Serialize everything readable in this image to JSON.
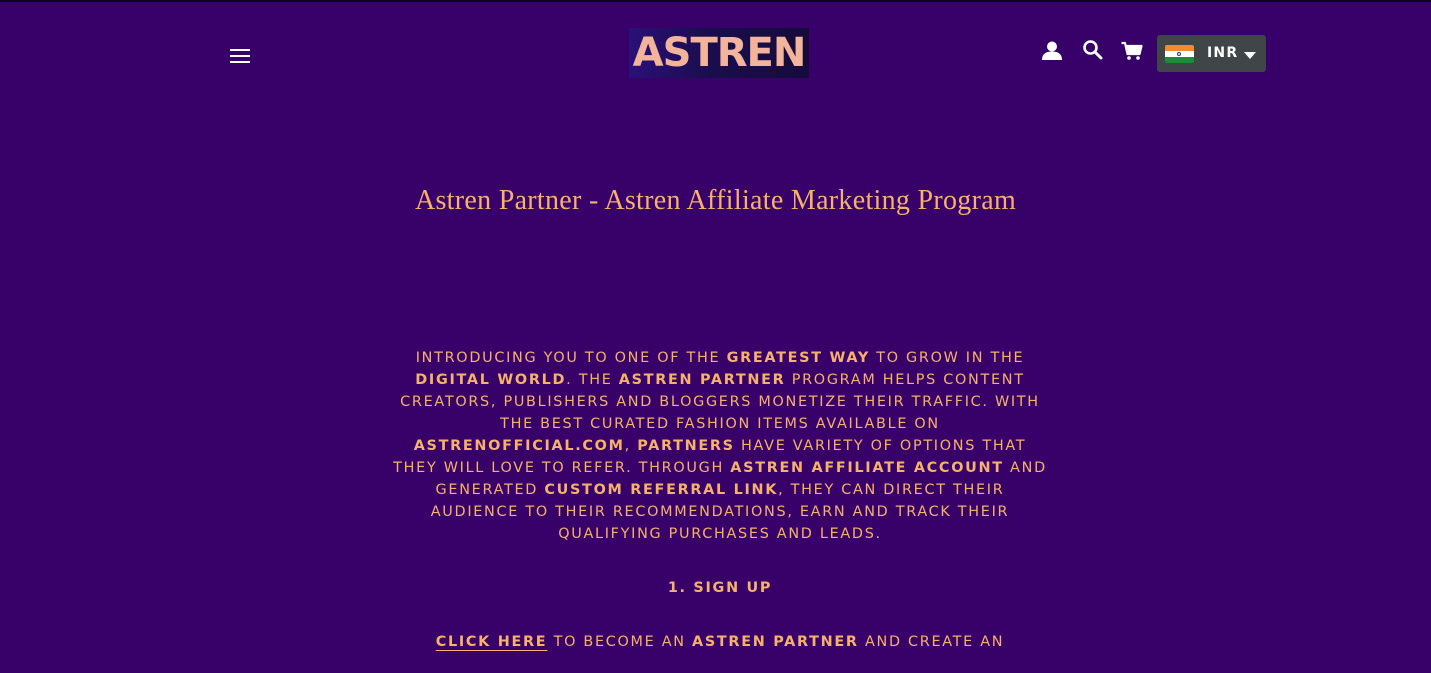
{
  "header": {
    "logo_text": "ASTREN",
    "menu_icon": "hamburger-menu-icon",
    "account_icon": "user-icon",
    "search_icon": "search-icon",
    "cart_icon": "cart-icon",
    "currency": {
      "flag_icon": "india-flag-icon",
      "code": "INR",
      "caret_icon": "caret-down-icon"
    }
  },
  "page": {
    "title": "Astren Partner - Astren Affiliate Marketing Program"
  },
  "intro": {
    "t1": "Introducing you to one of the ",
    "b1": "greatest way",
    "t2": " to grow in the ",
    "b2": "digital world",
    "t3": ". The ",
    "b3": "Astren Partner",
    "t4": " program helps content creators, publishers and bloggers monetize their traffic. With the best curated fashion items available on ",
    "b4": "astrenofficial.com",
    "t5": ", ",
    "b5": "partners",
    "t6": " have variety of options that they will love to refer. Through ",
    "b6": "Astren Affiliate Account",
    "t7": " and generated ",
    "b7": "custom referral link",
    "t8": ", they can direct their audience to their recommendations, earn and track their qualifying purchases and leads."
  },
  "step1": {
    "heading": "1. Sign Up",
    "link_text": "Click Here",
    "t1": " to become an ",
    "b1": "Astren Partner",
    "t2": " and create an"
  },
  "colors": {
    "background": "#38016a",
    "text_accent": "#f6b26b",
    "currency_bg": "#404548",
    "logo_text": "#f2b59b"
  }
}
